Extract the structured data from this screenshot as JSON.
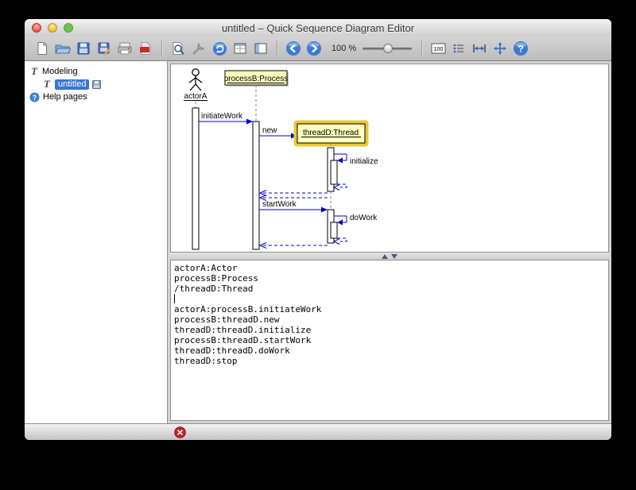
{
  "window": {
    "title": "untitled – Quick Sequence Diagram Editor"
  },
  "toolbar": {
    "zoom_label": "100 %",
    "buttons": [
      "new-document",
      "open-folder",
      "save",
      "save-as",
      "print",
      "export-pdf",
      "zoom-preview",
      "configure-wrench",
      "redraw",
      "table-view",
      "column-view",
      "nav-back",
      "nav-forward",
      "actual-size",
      "list",
      "fit-width",
      "fit-page",
      "help"
    ]
  },
  "icons": {
    "help_glyph": "?",
    "logo_glyph": "T",
    "actual_size_glyph": "100"
  },
  "sidebar": {
    "items": [
      {
        "label": "Modeling"
      },
      {
        "label": "untitled"
      },
      {
        "label": "Help pages"
      }
    ]
  },
  "diagram": {
    "actor": "actorA",
    "process": "processB:Process",
    "thread": "threadD:Thread",
    "msg_initiateWork": "initiateWork",
    "msg_new": "new",
    "msg_initialize": "initialize",
    "msg_startWork": "startWork",
    "msg_doWork": "doWork"
  },
  "editor": {
    "lines": [
      "actorA:Actor",
      "processB:Process",
      "/threadD:Thread",
      "",
      "actorA:processB.initiateWork",
      "processB:threadD.new",
      "threadD:threadD.initialize",
      "processB:threadD.startWork",
      "threadD:threadD.doWork",
      "threadD:stop"
    ]
  },
  "colors": {
    "selection_blue": "#3875d7",
    "arrow_blue": "#0000cc",
    "object_yellow": "#ffffc0",
    "highlight_border": "#e9c835",
    "error_red": "#cc2222"
  },
  "statusbar": {
    "icon": "error-icon"
  }
}
